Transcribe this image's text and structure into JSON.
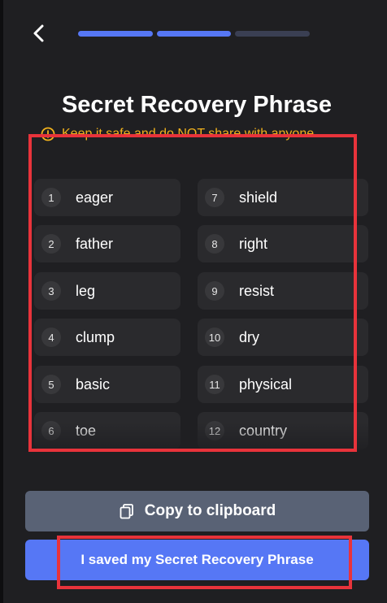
{
  "header": {
    "back_icon": "chevron-left-icon",
    "progress_steps": [
      {
        "state": "complete"
      },
      {
        "state": "complete"
      },
      {
        "state": "pending"
      }
    ]
  },
  "title": "Secret Recovery Phrase",
  "warning": {
    "icon": "warning-circle-icon",
    "text": "Keep it safe and do NOT share with anyone"
  },
  "words": [
    {
      "num": "1",
      "word": "eager"
    },
    {
      "num": "2",
      "word": "father"
    },
    {
      "num": "3",
      "word": "leg"
    },
    {
      "num": "4",
      "word": "clump"
    },
    {
      "num": "5",
      "word": "basic"
    },
    {
      "num": "6",
      "word": "toe"
    },
    {
      "num": "7",
      "word": "shield"
    },
    {
      "num": "8",
      "word": "right"
    },
    {
      "num": "9",
      "word": "resist"
    },
    {
      "num": "10",
      "word": "dry"
    },
    {
      "num": "11",
      "word": "physical"
    },
    {
      "num": "12",
      "word": "country"
    }
  ],
  "buttons": {
    "copy_label": "Copy to clipboard",
    "copy_icon": "copy-icon",
    "saved_label": "I saved my Secret Recovery Phrase"
  },
  "colors": {
    "accent": "#5677f5",
    "warning": "#f2b21c",
    "highlight": "#e8333b",
    "background": "#1f1f22"
  }
}
